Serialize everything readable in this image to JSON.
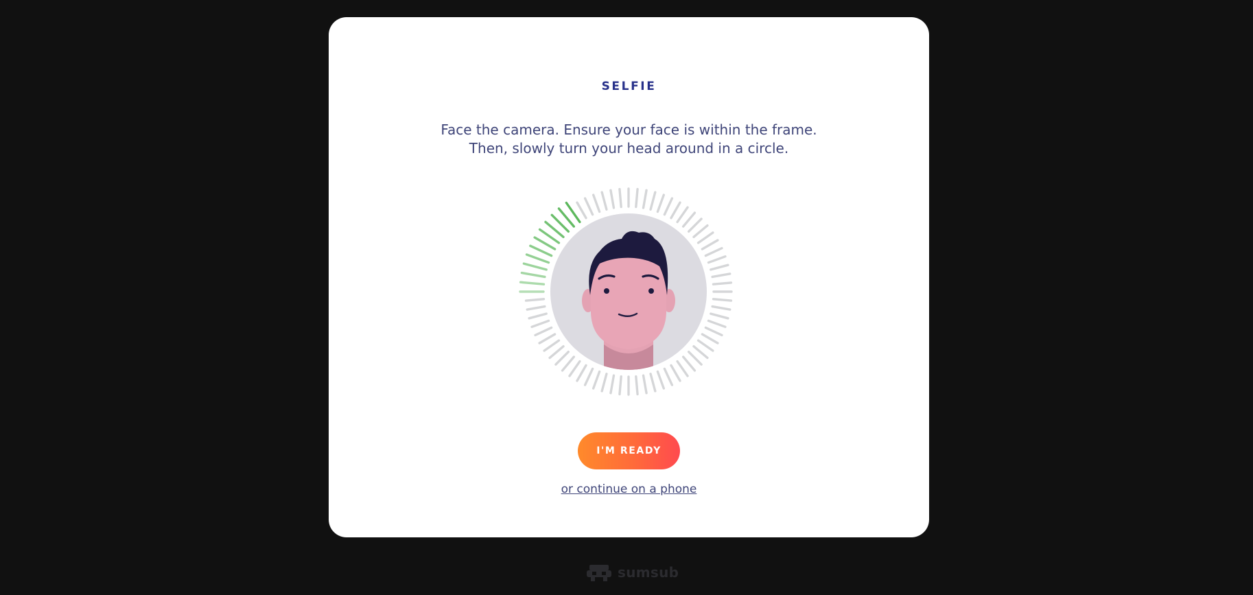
{
  "card": {
    "title": "SELFIE",
    "instruction_line1": "Face the camera. Ensure your face is within the frame.",
    "instruction_line2": "Then, slowly turn your head around in a circle.",
    "ready_button_label": "I'M READY",
    "phone_link_label": "or continue on a phone"
  },
  "face_progress": {
    "tick_count": 72,
    "completed_fraction": 0.17,
    "completed_color": "#5cb85c",
    "pending_color": "#d5d6d8"
  },
  "brand": {
    "name": "sumsub",
    "logo_icon": "sumsub-logo-icon"
  },
  "colors": {
    "background": "#111111",
    "card": "#ffffff",
    "title": "#27308a",
    "text": "#3e4478",
    "button_start": "#ff8a2b",
    "button_end": "#ff4a4f"
  }
}
